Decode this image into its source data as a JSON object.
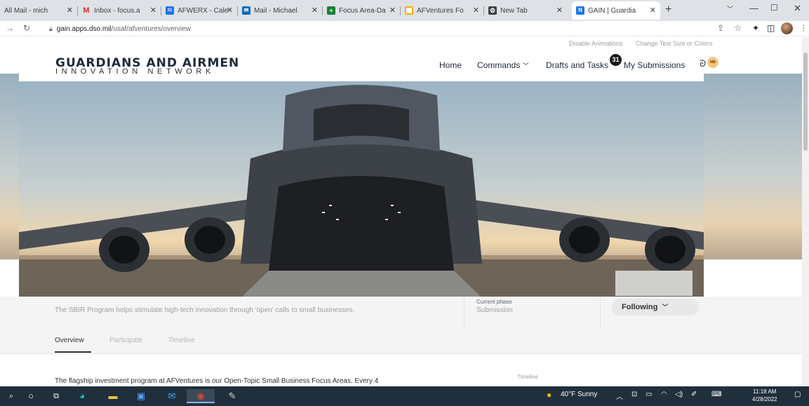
{
  "browser": {
    "tabs": [
      {
        "label": "All Mail - mich",
        "fav_color": "#dee1e6",
        "fav_char": ""
      },
      {
        "label": "Inbox - focus.a",
        "fav_color": "#ffffff",
        "fav_char": "M"
      },
      {
        "label": "AFWERX - Cale",
        "fav_color": "#1a73e8",
        "fav_char": "31"
      },
      {
        "label": "Mail - Michael",
        "fav_color": "#0f6cbd",
        "fav_char": "✉"
      },
      {
        "label": "Focus Area-Da",
        "fav_color": "#188038",
        "fav_char": "+"
      },
      {
        "label": "AFVentures Fo",
        "fav_color": "#f9ab00",
        "fav_char": ""
      },
      {
        "label": "New Tab",
        "fav_color": "#3c4043",
        "fav_char": "⚙"
      },
      {
        "label": "GAIN | Guardia",
        "fav_color": "#1a73e8",
        "fav_char": "N"
      }
    ],
    "url_domain": "gain.apps.dso.mil",
    "url_path": "/usaf/afventures/overview"
  },
  "site": {
    "utility": {
      "disable_animations": "Disable Animations",
      "change_text": "Change Text Size or Colors"
    },
    "logo_line1": "GUARDIANS AND AIRMEN",
    "logo_line2": "INNOVATION NETWORK",
    "nav": {
      "home": "Home",
      "commands": "Commands",
      "drafts": "Drafts and Tasks",
      "drafts_count": "31",
      "submissions": "My Submissions"
    },
    "user_initials": "MB"
  },
  "program": {
    "description": "The SBIR Program helps stimulate high-tech innovation through 'open' calls to small businesses.",
    "phase_label": "Current phase",
    "phase_value": "Submission",
    "follow_label": "Following"
  },
  "tabs": [
    "Overview",
    "Participate",
    "Timeline"
  ],
  "active_tab": "Overview",
  "overview": {
    "paragraph": "The flagship investment program at AFVentures is our Open-Topic Small Business Focus Areas. Every 4",
    "timeline_heading": "Timeline"
  },
  "taskbar": {
    "weather": "40°F  Sunny",
    "time": "11:18 AM",
    "date": "4/28/2022"
  }
}
